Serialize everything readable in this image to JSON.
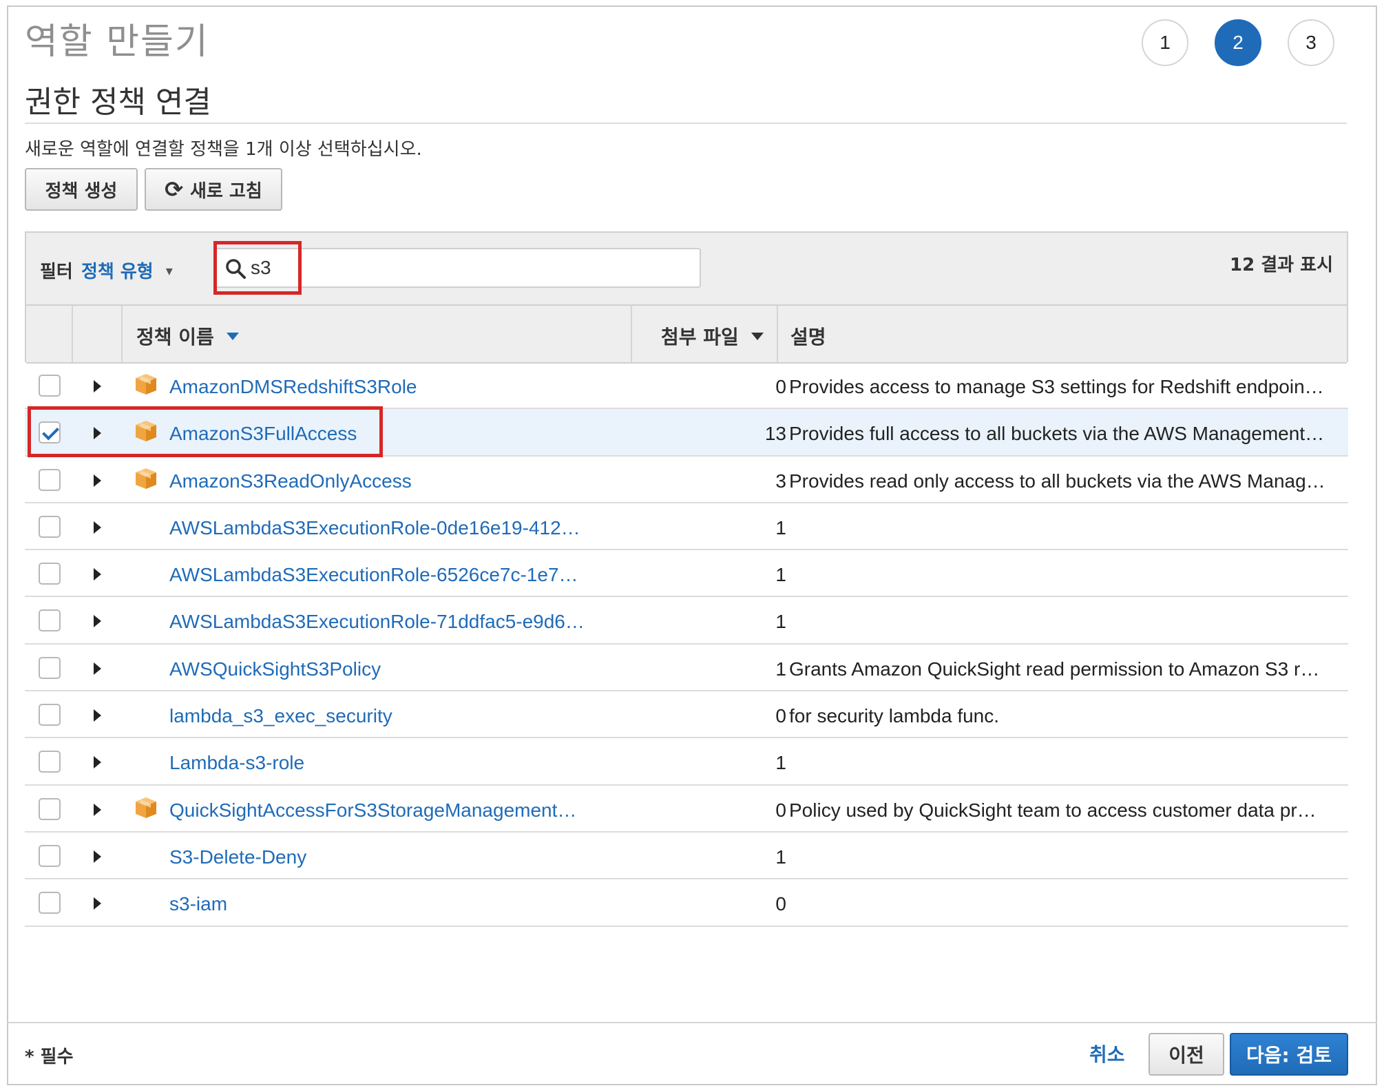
{
  "page": {
    "title": "역할 만들기"
  },
  "steps": [
    {
      "label": "1",
      "active": false
    },
    {
      "label": "2",
      "active": true
    },
    {
      "label": "3",
      "active": false
    }
  ],
  "section": {
    "title": "권한 정책 연결",
    "description": "새로운 역할에 연결할 정책을 1개 이상 선택하십시오."
  },
  "toolbar": {
    "create_policy_label": "정책 생성",
    "refresh_label": "새로 고침"
  },
  "filter": {
    "label": "필터",
    "type_label": "정책 유형",
    "search_value": "s3",
    "result_count": "12 결과 표시"
  },
  "columns": {
    "name": "정책 이름",
    "attachments": "첨부 파일",
    "description": "설명"
  },
  "policies": [
    {
      "name": "AmazonDMSRedshiftS3Role",
      "count": "0",
      "description": "Provides access to manage S3 settings for Redshift endpoin…",
      "aws_managed": true,
      "checked": false
    },
    {
      "name": "AmazonS3FullAccess",
      "count": "13",
      "description": "Provides full access to all buckets via the AWS Management…",
      "aws_managed": true,
      "checked": true
    },
    {
      "name": "AmazonS3ReadOnlyAccess",
      "count": "3",
      "description": "Provides read only access to all buckets via the AWS Manag…",
      "aws_managed": true,
      "checked": false
    },
    {
      "name": "AWSLambdaS3ExecutionRole-0de16e19-412…",
      "count": "1",
      "description": "",
      "aws_managed": false,
      "checked": false
    },
    {
      "name": "AWSLambdaS3ExecutionRole-6526ce7c-1e7…",
      "count": "1",
      "description": "",
      "aws_managed": false,
      "checked": false
    },
    {
      "name": "AWSLambdaS3ExecutionRole-71ddfac5-e9d6…",
      "count": "1",
      "description": "",
      "aws_managed": false,
      "checked": false
    },
    {
      "name": "AWSQuickSightS3Policy",
      "count": "1",
      "description": "Grants Amazon QuickSight read permission to Amazon S3 r…",
      "aws_managed": false,
      "checked": false
    },
    {
      "name": "lambda_s3_exec_security",
      "count": "0",
      "description": "for security lambda func.",
      "aws_managed": false,
      "checked": false
    },
    {
      "name": "Lambda-s3-role",
      "count": "1",
      "description": "",
      "aws_managed": false,
      "checked": false
    },
    {
      "name": "QuickSightAccessForS3StorageManagement…",
      "count": "0",
      "description": "Policy used by QuickSight team to access customer data pr…",
      "aws_managed": true,
      "checked": false
    },
    {
      "name": "S3-Delete-Deny",
      "count": "1",
      "description": "",
      "aws_managed": false,
      "checked": false
    },
    {
      "name": "s3-iam",
      "count": "0",
      "description": "",
      "aws_managed": false,
      "checked": false
    }
  ],
  "footer": {
    "required_label": "* 필수",
    "cancel_label": "취소",
    "previous_label": "이전",
    "next_label": "다음: 검토"
  },
  "colors": {
    "accent": "#1f6bb8",
    "highlight": "#d62727",
    "aws_managed_icon": "#f0a541"
  },
  "icons": {
    "aws_managed": "aws-managed-policy-icon",
    "search": "search-icon",
    "refresh": "refresh-icon"
  }
}
